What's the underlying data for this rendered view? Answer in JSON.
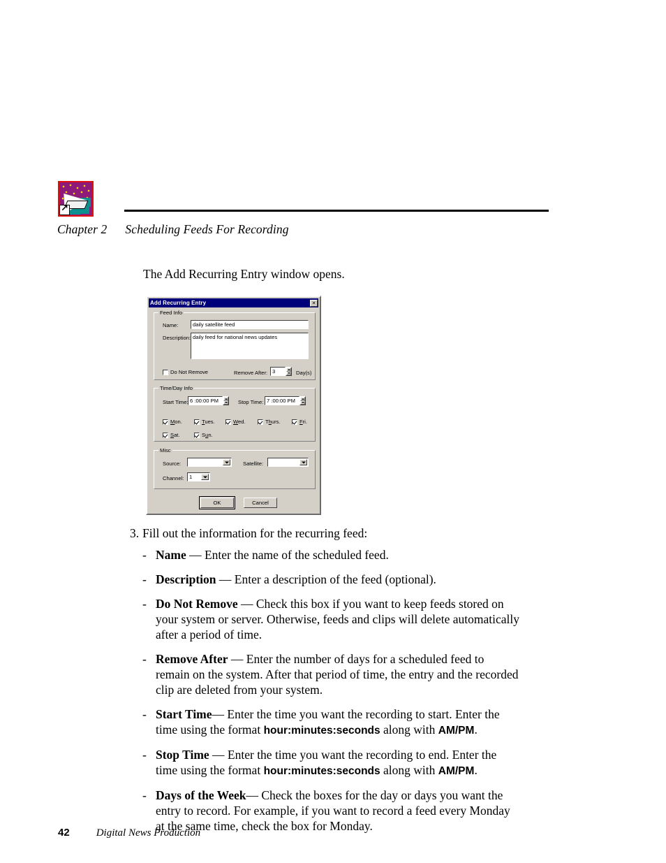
{
  "page": {
    "chapter_label": "Chapter 2",
    "chapter_title": "Scheduling Feeds For Recording",
    "intro_text": "The Add Recurring Entry window opens.",
    "icon_name": "satellite-feed-shortcut-icon"
  },
  "dialog": {
    "title": "Add Recurring Entry",
    "close_glyph": "✕",
    "groups": {
      "feed_info": {
        "legend": "Feed Info",
        "name_label": "Name:",
        "name_value": "daily satellite feed",
        "description_label": "Description:",
        "description_value": "daily feed for national news updates",
        "do_not_remove_label": "Do Not Remove",
        "do_not_remove_checked": false,
        "remove_after_label": "Remove After:",
        "remove_after_value": "3",
        "days_label": "Day(s)"
      },
      "time_day_info": {
        "legend": "Time/Day Info",
        "start_time_label": "Start Time:",
        "start_time_value": "6 :00:00 PM",
        "stop_time_label": "Stop Time:",
        "stop_time_value": "7 :00:00 PM",
        "days": [
          {
            "label": "Mon.",
            "accel": "M",
            "checked": true
          },
          {
            "label": "Tues.",
            "accel": "T",
            "checked": true
          },
          {
            "label": "Wed.",
            "accel": "W",
            "checked": true
          },
          {
            "label": "Thurs.",
            "accel": "h",
            "checked": true
          },
          {
            "label": "Fri.",
            "accel": "F",
            "checked": true
          },
          {
            "label": "Sat.",
            "accel": "S",
            "checked": true
          },
          {
            "label": "Sun.",
            "accel": "u",
            "checked": true
          }
        ]
      },
      "misc": {
        "legend": "Misc",
        "source_label": "Source:",
        "source_value": "",
        "satellite_label": "Satellite:",
        "satellite_value": "",
        "channel_label": "Channel:",
        "channel_value": "1"
      }
    },
    "buttons": {
      "ok": "OK",
      "cancel": "Cancel"
    },
    "colors": {
      "titlebar": "#00007b",
      "face": "#d4d0c8",
      "title_text": "#ffffff"
    }
  },
  "instructions": {
    "step_number": "3.",
    "step_text": "Fill out the information for the recurring feed:",
    "items": [
      {
        "dash": "-",
        "term": "Name",
        "sep": " — ",
        "body_1": "Enter the name of the scheduled feed.",
        "emphasis_1": "",
        "body_2": "",
        "emphasis_2": "",
        "body_3": ""
      },
      {
        "dash": "-",
        "term": "Description",
        "sep": " — ",
        "body_1": "Enter a description of the feed (optional).",
        "emphasis_1": "",
        "body_2": "",
        "emphasis_2": "",
        "body_3": ""
      },
      {
        "dash": "-",
        "term": "Do Not Remove",
        "sep": " — ",
        "body_1": "Check this box if you want to keep feeds stored on your system or server. Otherwise, feeds and clips will delete automatically after a period of time.",
        "emphasis_1": "",
        "body_2": "",
        "emphasis_2": "",
        "body_3": ""
      },
      {
        "dash": "-",
        "term": "Remove After",
        "sep": " — ",
        "body_1": "Enter the number of days for a scheduled feed to remain on the system. After that period of time, the entry and the recorded clip are deleted from your system.",
        "emphasis_1": "",
        "body_2": "",
        "emphasis_2": "",
        "body_3": ""
      },
      {
        "dash": "-",
        "term": "Start Time",
        "sep": "— ",
        "body_1": "Enter the time you want the recording to start. Enter the time using the format ",
        "emphasis_1": "hour:minutes:seconds",
        "body_2": " along with ",
        "emphasis_2": "AM/PM",
        "body_3": "."
      },
      {
        "dash": "-",
        "term": "Stop Time",
        "sep": " — ",
        "body_1": "Enter the time you want the recording to end. Enter the time using the format ",
        "emphasis_1": "hour:minutes:seconds",
        "body_2": " along with ",
        "emphasis_2": "AM/PM",
        "body_3": "."
      },
      {
        "dash": "-",
        "term": "Days of the Week",
        "sep": "— ",
        "body_1": "Check the boxes for the day or days you want the entry to record. For example, if you want to record a feed every Monday at the same time, check the box for Monday.",
        "emphasis_1": "",
        "body_2": "",
        "emphasis_2": "",
        "body_3": ""
      }
    ]
  },
  "footer": {
    "page_number": "42",
    "book_title": "Digital News Production"
  }
}
